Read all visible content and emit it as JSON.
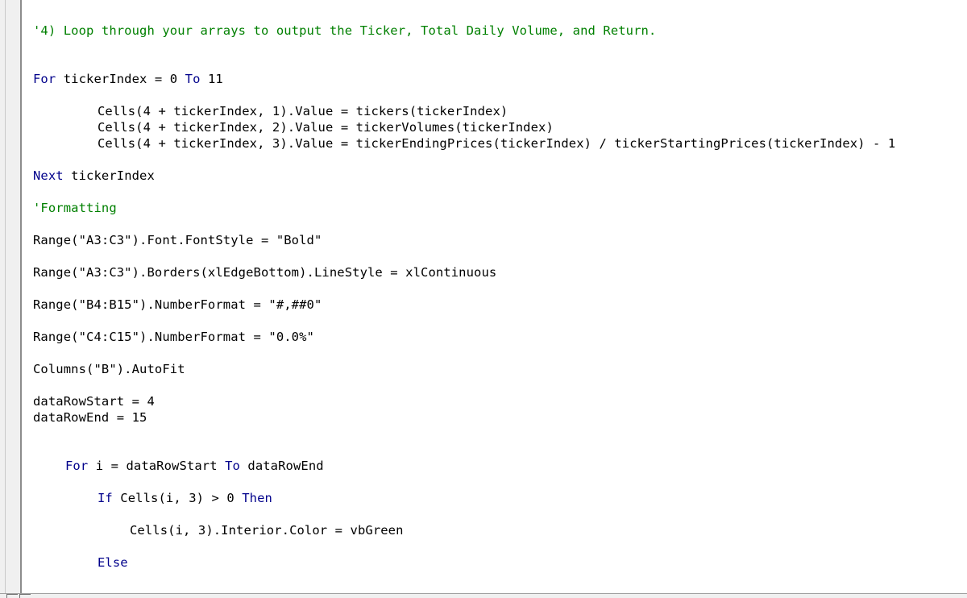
{
  "editor": {
    "lines": [
      {
        "parts": [
          {
            "t": "'4) Loop through your arrays to output the Ticker, Total Daily Volume, and Return.",
            "k": "cm"
          }
        ]
      },
      {
        "parts": [
          {
            "t": "For",
            "k": "kw"
          },
          {
            "t": " tickerIndex = 0 ",
            "k": ""
          },
          {
            "t": "To",
            "k": "kw"
          },
          {
            "t": " 11",
            "k": ""
          }
        ]
      },
      {
        "parts": [
          {
            "t": "Cells(4 + tickerIndex, 1).Value = tickers(tickerIndex)",
            "k": ""
          }
        ]
      },
      {
        "parts": [
          {
            "t": "Cells(4 + tickerIndex, 2).Value = tickerVolumes(tickerIndex)",
            "k": ""
          }
        ]
      },
      {
        "parts": [
          {
            "t": "Cells(4 + tickerIndex, 3).Value = tickerEndingPrices(tickerIndex) / tickerStartingPrices(tickerIndex) - 1",
            "k": ""
          }
        ]
      },
      {
        "parts": [
          {
            "t": "Next",
            "k": "kw"
          },
          {
            "t": " tickerIndex",
            "k": ""
          }
        ]
      },
      {
        "parts": [
          {
            "t": "'Formatting",
            "k": "cm"
          }
        ]
      },
      {
        "parts": [
          {
            "t": "Range(\"A3:C3\").Font.FontStyle = \"Bold\"",
            "k": ""
          }
        ]
      },
      {
        "parts": [
          {
            "t": "Range(\"A3:C3\").Borders(xlEdgeBottom).LineStyle = xlContinuous",
            "k": ""
          }
        ]
      },
      {
        "parts": [
          {
            "t": "Range(\"B4:B15\").NumberFormat = \"#,##0\"",
            "k": ""
          }
        ]
      },
      {
        "parts": [
          {
            "t": "Range(\"C4:C15\").NumberFormat = \"0.0%\"",
            "k": ""
          }
        ]
      },
      {
        "parts": [
          {
            "t": "Columns(\"B\").AutoFit",
            "k": ""
          }
        ]
      },
      {
        "parts": [
          {
            "t": "dataRowStart = 4",
            "k": ""
          }
        ]
      },
      {
        "parts": [
          {
            "t": "dataRowEnd = 15",
            "k": ""
          }
        ]
      },
      {
        "parts": [
          {
            "t": "For",
            "k": "kw"
          },
          {
            "t": " i = dataRowStart ",
            "k": ""
          },
          {
            "t": "To",
            "k": "kw"
          },
          {
            "t": " dataRowEnd",
            "k": ""
          }
        ]
      },
      {
        "parts": [
          {
            "t": "If",
            "k": "kw"
          },
          {
            "t": " Cells(i, 3) > 0 ",
            "k": ""
          },
          {
            "t": "Then",
            "k": "kw"
          }
        ]
      },
      {
        "parts": [
          {
            "t": "Cells(i, 3).Interior.Color = vbGreen",
            "k": ""
          }
        ]
      },
      {
        "parts": [
          {
            "t": "Else",
            "k": "kw"
          }
        ]
      }
    ]
  },
  "colors": {
    "keyword": "#00008b",
    "comment": "#008000",
    "text": "#000000",
    "background": "#ffffff"
  }
}
